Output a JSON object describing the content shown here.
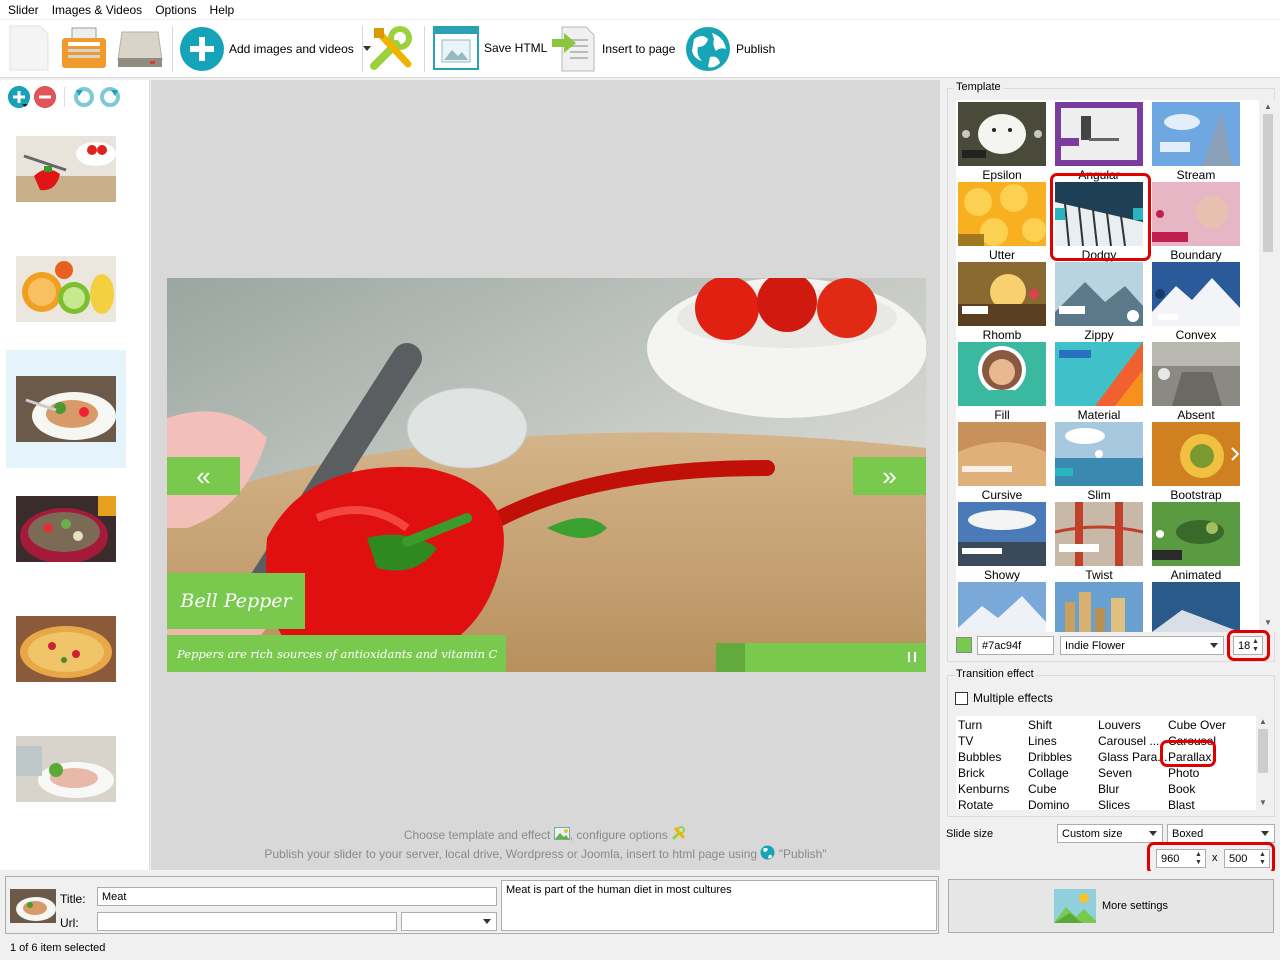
{
  "menu": [
    "Slider",
    "Images & Videos",
    "Options",
    "Help"
  ],
  "toolbar": {
    "add_label": "Add images and videos",
    "save_label": "Save HTML",
    "insert_label": "Insert to page",
    "publish_label": "Publish"
  },
  "slide": {
    "title": "Bell Pepper",
    "description": "Peppers are rich sources of antioxidants and vitamin C",
    "prev_glyph": "«",
    "next_glyph": "»",
    "progress": 0.14
  },
  "hints": {
    "line1": "Choose template and effect",
    "line1b": ", configure options",
    "line2": "Publish your slider to your server, local drive, Wordpress or Joomla, insert to html page using",
    "line2b": "\"Publish\""
  },
  "template": {
    "group_label": "Template",
    "names": [
      "Epsilon",
      "Angular",
      "Stream",
      "Utter",
      "Dodgy",
      "Boundary",
      "Rhomb",
      "Zippy",
      "Convex",
      "Fill",
      "Material",
      "Absent",
      "Cursive",
      "Slim",
      "Bootstrap",
      "Showy",
      "Twist",
      "Animated"
    ],
    "color": "#7ac94f",
    "color_value": "#7ac94f",
    "font": "Indie Flower",
    "font_size": "18"
  },
  "transition": {
    "group_label": "Transition effect",
    "multiple_label": "Multiple effects",
    "columns": [
      [
        "Turn",
        "TV",
        "Bubbles",
        "Brick",
        "Kenburns",
        "Rotate"
      ],
      [
        "Shift",
        "Lines",
        "Dribbles",
        "Collage",
        "Cube",
        "Domino"
      ],
      [
        "Louvers",
        "Carousel ...",
        "Glass Para...",
        "Seven",
        "Blur",
        "Slices"
      ],
      [
        "Cube Over",
        "Carousel",
        "Parallax",
        "Photo",
        "Book",
        "Blast"
      ]
    ]
  },
  "slide_size": {
    "label": "Slide size",
    "mode": "Custom size",
    "layout": "Boxed",
    "width": "960",
    "height": "500",
    "x_label": "x"
  },
  "item": {
    "title_label": "Title:",
    "url_label": "Url:",
    "title_value": "Meat",
    "url_value": "",
    "target_value": "",
    "description": "Meat is part of the human diet in most cultures"
  },
  "more_settings": "More settings",
  "status": "1 of 6 item selected"
}
